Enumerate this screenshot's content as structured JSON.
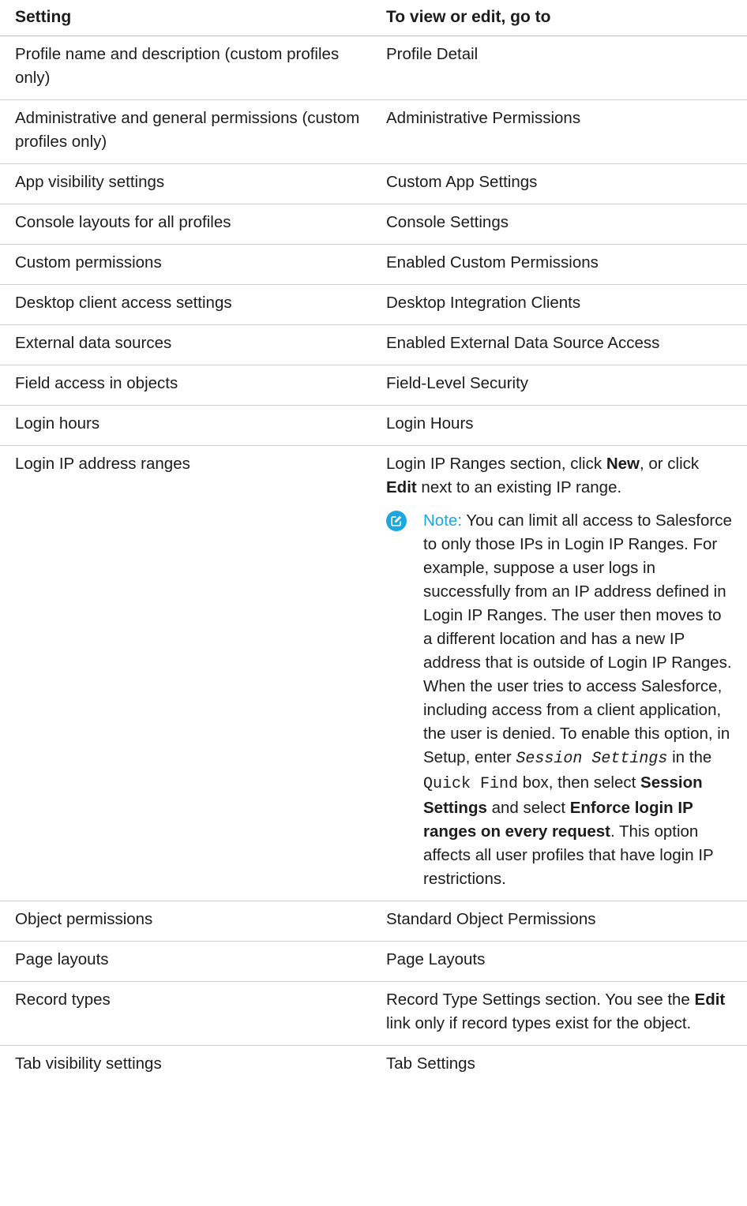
{
  "header": {
    "setting": "Setting",
    "location": "To view or edit, go to"
  },
  "rows": [
    {
      "setting": "Profile name and description (custom profiles only)",
      "location": "Profile Detail"
    },
    {
      "setting": "Administrative and general permissions (custom profiles only)",
      "location": "Administrative Permissions"
    },
    {
      "setting": "App visibility settings",
      "location": "Custom App Settings"
    },
    {
      "setting": "Console layouts for all profiles",
      "location": "Console Settings"
    },
    {
      "setting": "Custom permissions",
      "location": "Enabled Custom Permissions"
    },
    {
      "setting": "Desktop client access settings",
      "location": "Desktop Integration Clients"
    },
    {
      "setting": "External data sources",
      "location": "Enabled External Data Source Access"
    },
    {
      "setting": "Field access in objects",
      "location": "Field-Level Security"
    },
    {
      "setting": "Login hours",
      "location": "Login Hours"
    },
    {
      "setting": "Login IP address ranges"
    },
    {
      "setting": "Object permissions",
      "location": "Standard Object Permissions"
    },
    {
      "setting": "Page layouts",
      "location": "Page Layouts"
    },
    {
      "setting": "Record types"
    },
    {
      "setting": "Tab visibility settings",
      "location": "Tab Settings"
    }
  ],
  "login_ip": {
    "p1": "Login IP Ranges section, click ",
    "new": "New",
    "p2": ", or click ",
    "edit": "Edit",
    "p3": " next to an existing IP range.",
    "note_icon": "edit-note-icon",
    "note_label": "Note:",
    "n1": " You can limit all access to Salesforce to only those IPs in Login IP Ranges. For example, suppose a user logs in successfully from an IP address defined in Login IP Ranges. The user then moves to a different location and has a new IP address that is outside of Login IP Ranges. When the user tries to access Salesforce, including access from a client application, the user is denied. To enable this option, in Setup, enter ",
    "session_settings_input": "Session Settings",
    "n2": " in the ",
    "quick_find": "Quick Find",
    "n3": " box, then select ",
    "session_settings_link": "Session Settings",
    "n4": " and select ",
    "enforce": "Enforce login IP ranges on every request",
    "n5": ". This option affects all user profiles that have login IP restrictions."
  },
  "record_types": {
    "p1": "Record Type Settings section. You see the ",
    "edit": "Edit",
    "p2": " link only if record types exist for the object."
  },
  "colors": {
    "accent": "#1ba7e0",
    "divider": "#cfcfcf"
  }
}
